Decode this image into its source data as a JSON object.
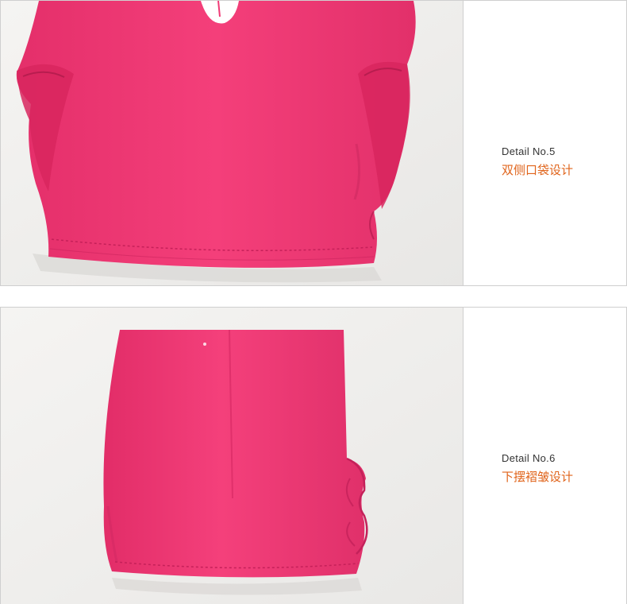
{
  "details": [
    {
      "title": "Detail No.5",
      "subtitle": "双侧口袋设计",
      "garment_color": "#f03a76"
    },
    {
      "title": "Detail No.6",
      "subtitle": "下摆褶皱设计",
      "garment_color": "#f03a76"
    }
  ],
  "colors": {
    "accent": "#e0641b",
    "border": "#cfcfcf",
    "photo_background": "#f0efed"
  }
}
